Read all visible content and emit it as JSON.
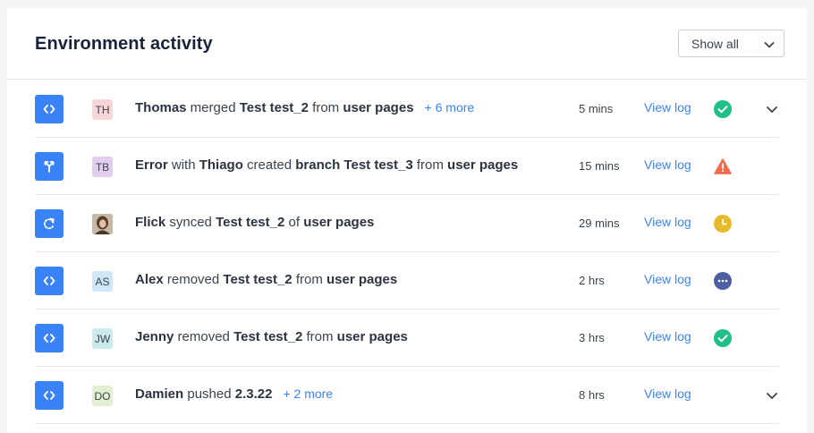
{
  "header": {
    "title": "Environment activity",
    "filter_value": "Show all"
  },
  "colors": {
    "accent": "#3a82f7",
    "success": "#1fbf8a",
    "warning": "#f46a4a",
    "pending": "#e8b92a",
    "in_progress": "#4f5fa3"
  },
  "rows": [
    {
      "type_icon": "code-icon",
      "avatar": "TH",
      "avatar_color": "#f8d6d8",
      "parts": [
        "Thomas",
        " merged ",
        "Test test_2",
        " from ",
        "user pages"
      ],
      "more": "+ 6 more",
      "time": "5 mins",
      "view_log": "View log",
      "status": "success-icon",
      "expandable": true
    },
    {
      "type_icon": "branch-icon",
      "avatar": "TB",
      "avatar_color": "#e2cdef",
      "parts": [
        "Error",
        " with ",
        "Thiago",
        " created ",
        "branch Test test_3",
        " from ",
        "user pages"
      ],
      "more": "",
      "time": "15 mins",
      "view_log": "View log",
      "status": "warning-icon",
      "expandable": false
    },
    {
      "type_icon": "sync-icon",
      "avatar": "",
      "avatar_color": "#8a6a55",
      "parts": [
        "Flick",
        " synced ",
        "Test test_2",
        " of ",
        "user pages"
      ],
      "more": "",
      "time": "29 mins",
      "view_log": "View log",
      "status": "pending-icon",
      "expandable": false
    },
    {
      "type_icon": "code-icon",
      "avatar": "AS",
      "avatar_color": "#cfe7f7",
      "parts": [
        "Alex",
        " removed ",
        "Test test_2",
        " from ",
        "user pages"
      ],
      "more": "",
      "time": "2 hrs",
      "view_log": "View log",
      "status": "in-progress-icon",
      "expandable": false
    },
    {
      "type_icon": "code-icon",
      "avatar": "JW",
      "avatar_color": "#cbeaec",
      "parts": [
        "Jenny",
        " removed ",
        "Test test_2",
        " from ",
        "user pages"
      ],
      "more": "",
      "time": "3 hrs",
      "view_log": "View log",
      "status": "success-icon",
      "expandable": false
    },
    {
      "type_icon": "code-icon",
      "avatar": "DO",
      "avatar_color": "#e2efd1",
      "parts": [
        "Damien",
        " pushed ",
        "2.3.22"
      ],
      "more": "+ 2 more",
      "time": "8 hrs",
      "view_log": "View log",
      "status": "",
      "expandable": true
    }
  ]
}
